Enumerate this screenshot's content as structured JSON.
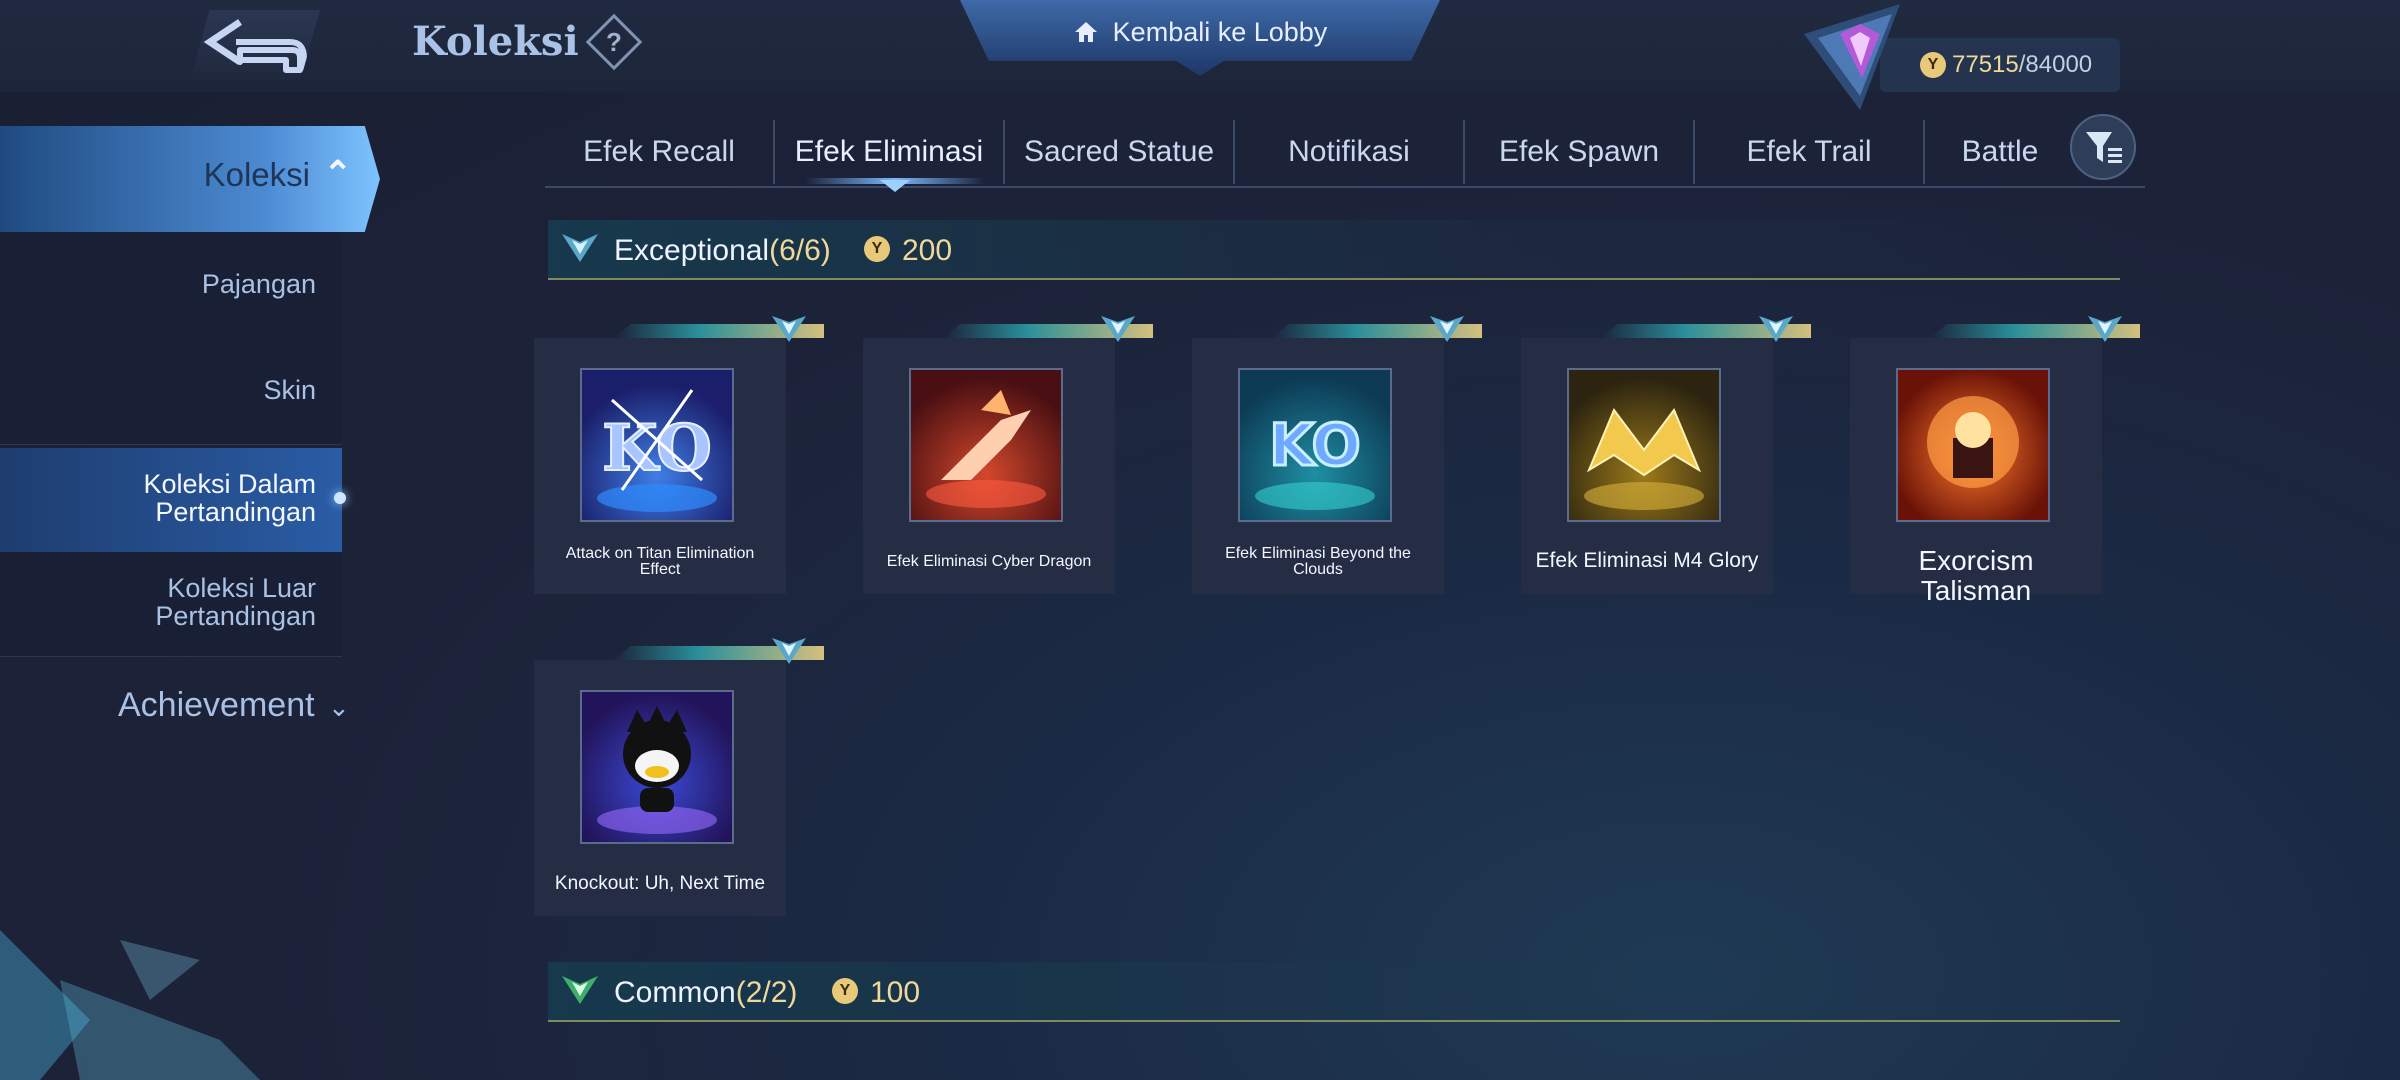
{
  "header": {
    "title": "Koleksi",
    "help": "?",
    "lobby_label": "Kembali ke Lobby",
    "points_current": "77515",
    "points_max": "/84000"
  },
  "sidebar": {
    "main": "Koleksi",
    "items": [
      "Pajangan",
      "Skin",
      "Koleksi Dalam Pertandingan",
      "Koleksi Luar Pertandingan"
    ],
    "achievement": "Achievement"
  },
  "tabs": [
    "Efek Recall",
    "Efek Eliminasi",
    "Sacred Statue",
    "Notifikasi",
    "Efek Spawn",
    "Efek Trail",
    "Battle"
  ],
  "active_tab": "Efek Eliminasi",
  "sections": [
    {
      "name": "Exceptional",
      "count": "(6/6)",
      "price": "200",
      "items": [
        "Attack on Titan Elimination Effect",
        "Efek Eliminasi Cyber Dragon",
        "Efek Eliminasi Beyond the Clouds",
        "Efek Eliminasi M4 Glory",
        "Exorcism Talisman",
        "Knockout: Uh, Next Time"
      ]
    },
    {
      "name": "Common",
      "count": "(2/2)",
      "price": "100",
      "items": []
    }
  ],
  "colors": {
    "accent": "#4c8bd3",
    "gold": "#f0d89a",
    "background": "#1c2238"
  }
}
